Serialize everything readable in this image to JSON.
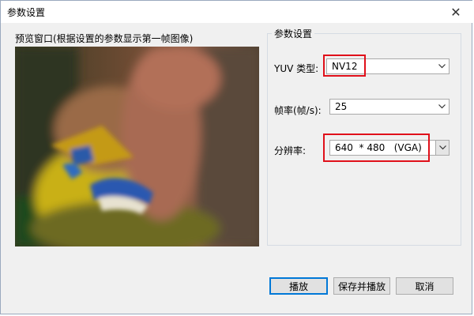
{
  "window": {
    "title": "参数设置",
    "close_glyph": "✕"
  },
  "preview": {
    "label": "预览窗口(根据设置的参数显示第一帧图像)"
  },
  "settings": {
    "group_title": "参数设置",
    "yuv": {
      "label": "YUV 类型:",
      "value": "NV12"
    },
    "fps": {
      "label": "帧率(帧/s):",
      "value": "25"
    },
    "resolution": {
      "label": "分辨率:",
      "value": "640  * 480   (VGA)"
    }
  },
  "buttons": {
    "play": "播放",
    "save_play": "保存并播放",
    "cancel": "取消"
  },
  "colors": {
    "highlight": "#e0101a",
    "default_button_border": "#0078d7"
  },
  "icons": {
    "close": "close-icon",
    "dropdown": "chevron-down-icon"
  }
}
